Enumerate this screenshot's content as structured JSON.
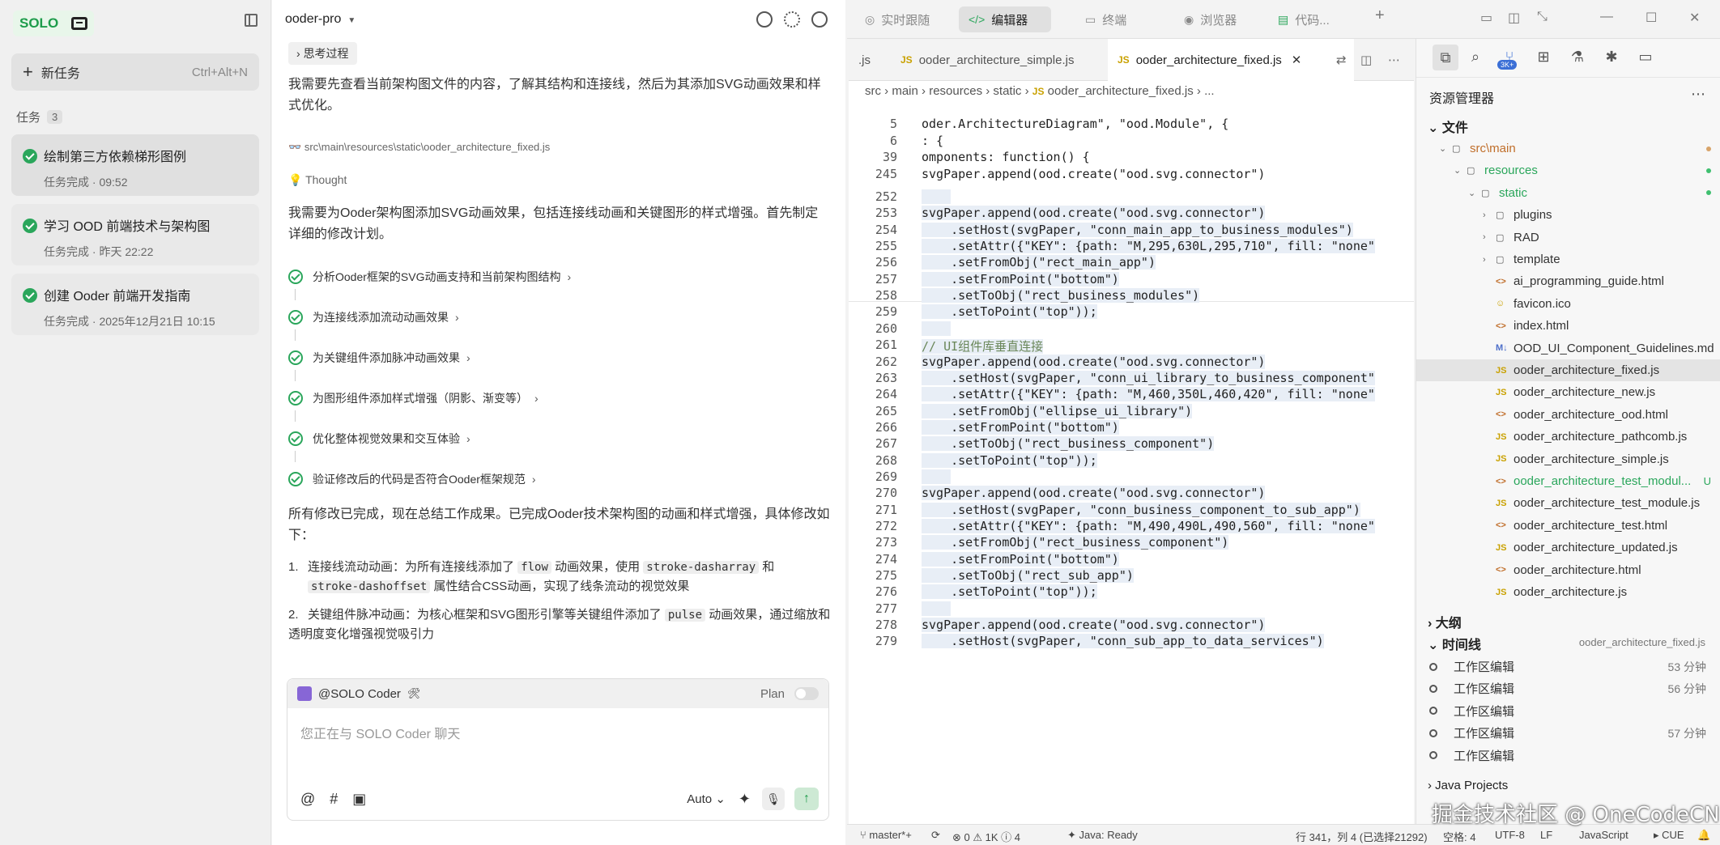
{
  "sidebar": {
    "logo": "SOLO",
    "new_task": "新任务",
    "new_task_shortcut": "Ctrl+Alt+N",
    "tasks_label": "任务",
    "tasks_count": "3",
    "tasks": [
      {
        "title": "绘制第三方依赖梯形图例",
        "status": "任务完成 · 09:52"
      },
      {
        "title": "学习 OOD 前端技术与架构图",
        "status": "任务完成 · 昨天 22:22"
      },
      {
        "title": "创建 Ooder 前端开发指南",
        "status": "任务完成 · 2025年12月21日 10:15"
      }
    ]
  },
  "chat": {
    "project": "ooder-pro",
    "thinking": "思考过程",
    "intro": "我需要先查看当前架构图文件的内容，了解其结构和连接线，然后为其添加SVG动画效果和样式优化。",
    "file_path": "src\\main\\resources\\static\\ooder_architecture_fixed.js",
    "thought": "Thought",
    "plan": "我需要为Ooder架构图添加SVG动画效果，包括连接线动画和关键图形的样式增强。首先制定详细的修改计划。",
    "steps": [
      "分析Ooder框架的SVG动画支持和当前架构图结构",
      "为连接线添加流动动画效果",
      "为关键组件添加脉冲动画效果",
      "为图形组件添加样式增强（阴影、渐变等）",
      "优化整体视觉效果和交互体验",
      "验证修改后的代码是否符合Ooder框架规范"
    ],
    "summary": "所有修改已完成，现在总结工作成果。已完成Ooder技术架构图的动画和样式增强，具体修改如下：",
    "items": [
      {
        "num": "1.",
        "pre": "连接线流动动画：为所有连接线添加了",
        "c1": "flow",
        "mid": "动画效果，使用",
        "c2": "stroke-dasharray",
        "mid2": "和",
        "c3": "stroke-dashoffset",
        "post": "属性结合CSS动画，实现了线条流动的视觉效果"
      },
      {
        "num": "2.",
        "pre": "关键组件脉冲动画：为核心框架和SVG图形引擎等关键组件添加了",
        "c1": "pulse",
        "post": "动画效果，通过缩放和透明度变化增强视觉吸引力"
      }
    ],
    "composer": {
      "agent": "@SOLO Coder",
      "plan_label": "Plan",
      "placeholder": "您正在与 SOLO Coder 聊天",
      "mode": "Auto"
    }
  },
  "topbar": {
    "buttons": [
      "实时跟随",
      "编辑器",
      "终端",
      "浏览器",
      "代码..."
    ]
  },
  "editor": {
    "tabs": [
      ".js",
      "ooder_architecture_simple.js",
      "ooder_architecture_fixed.js"
    ],
    "breadcrumb": [
      "src",
      "main",
      "resources",
      "static",
      "ooder_architecture_fixed.js",
      "..."
    ],
    "sticky": [
      {
        "n": "5",
        "t": "oder.ArchitectureDiagram\", \"ood.Module\", {"
      },
      {
        "n": "6",
        "t": ": {"
      },
      {
        "n": "39",
        "t": "omponents: function() {"
      },
      {
        "n": "245",
        "t": "svgPaper.append(ood.create(\"ood.svg.connector\")"
      }
    ],
    "lines": [
      {
        "n": "252",
        "t": ""
      },
      {
        "n": "253",
        "t": "svgPaper.append(ood.create(\"ood.svg.connector\")"
      },
      {
        "n": "254",
        "t": "    .setHost(svgPaper, \"conn_main_app_to_business_modules\")"
      },
      {
        "n": "255",
        "t": "    .setAttr({\"KEY\": {path: \"M,295,630L,295,710\", fill: \"none\""
      },
      {
        "n": "256",
        "t": "    .setFromObj(\"rect_main_app\")"
      },
      {
        "n": "257",
        "t": "    .setFromPoint(\"bottom\")"
      },
      {
        "n": "258",
        "t": "    .setToObj(\"rect_business_modules\")"
      },
      {
        "n": "259",
        "t": "    .setToPoint(\"top\"));"
      },
      {
        "n": "260",
        "t": ""
      },
      {
        "n": "261",
        "t": "// UI组件库垂直连接"
      },
      {
        "n": "262",
        "t": "svgPaper.append(ood.create(\"ood.svg.connector\")"
      },
      {
        "n": "263",
        "t": "    .setHost(svgPaper, \"conn_ui_library_to_business_component\""
      },
      {
        "n": "264",
        "t": "    .setAttr({\"KEY\": {path: \"M,460,350L,460,420\", fill: \"none\""
      },
      {
        "n": "265",
        "t": "    .setFromObj(\"ellipse_ui_library\")"
      },
      {
        "n": "266",
        "t": "    .setFromPoint(\"bottom\")"
      },
      {
        "n": "267",
        "t": "    .setToObj(\"rect_business_component\")"
      },
      {
        "n": "268",
        "t": "    .setToPoint(\"top\"));"
      },
      {
        "n": "269",
        "t": ""
      },
      {
        "n": "270",
        "t": "svgPaper.append(ood.create(\"ood.svg.connector\")"
      },
      {
        "n": "271",
        "t": "    .setHost(svgPaper, \"conn_business_component_to_sub_app\")"
      },
      {
        "n": "272",
        "t": "    .setAttr({\"KEY\": {path: \"M,490,490L,490,560\", fill: \"none\""
      },
      {
        "n": "273",
        "t": "    .setFromObj(\"rect_business_component\")"
      },
      {
        "n": "274",
        "t": "    .setFromPoint(\"bottom\")"
      },
      {
        "n": "275",
        "t": "    .setToObj(\"rect_sub_app\")"
      },
      {
        "n": "276",
        "t": "    .setToPoint(\"top\"));"
      },
      {
        "n": "277",
        "t": ""
      },
      {
        "n": "278",
        "t": "svgPaper.append(ood.create(\"ood.svg.connector\")"
      },
      {
        "n": "279",
        "t": "    .setHost(svgPaper, \"conn_sub_app_to_data_services\")"
      }
    ]
  },
  "explorer": {
    "title": "资源管理器",
    "files_label": "文件",
    "tree": [
      {
        "label": "src\\main",
        "kind": "folder",
        "indent": 1,
        "open": true,
        "status": "dot-orange"
      },
      {
        "label": "resources",
        "kind": "folder",
        "indent": 2,
        "open": true,
        "status": "dot-green"
      },
      {
        "label": "static",
        "kind": "folder",
        "indent": 3,
        "open": true,
        "status": "dot-green"
      },
      {
        "label": "plugins",
        "kind": "folder",
        "indent": 4,
        "open": false
      },
      {
        "label": "RAD",
        "kind": "folder",
        "indent": 4,
        "open": false
      },
      {
        "label": "template",
        "kind": "folder",
        "indent": 4,
        "open": false
      },
      {
        "label": "ai_programming_guide.html",
        "kind": "html",
        "indent": 4
      },
      {
        "label": "favicon.ico",
        "kind": "ico",
        "indent": 4
      },
      {
        "label": "index.html",
        "kind": "html",
        "indent": 4
      },
      {
        "label": "OOD_UI_Component_Guidelines.md",
        "kind": "md",
        "indent": 4
      },
      {
        "label": "ooder_architecture_fixed.js",
        "kind": "js",
        "indent": 4,
        "selected": true
      },
      {
        "label": "ooder_architecture_new.js",
        "kind": "js",
        "indent": 4
      },
      {
        "label": "ooder_architecture_ood.html",
        "kind": "html",
        "indent": 4
      },
      {
        "label": "ooder_architecture_pathcomb.js",
        "kind": "js",
        "indent": 4
      },
      {
        "label": "ooder_architecture_simple.js",
        "kind": "js",
        "indent": 4
      },
      {
        "label": "ooder_architecture_test_modul...",
        "kind": "html",
        "indent": 4,
        "status": "U"
      },
      {
        "label": "ooder_architecture_test_module.js",
        "kind": "js",
        "indent": 4
      },
      {
        "label": "ooder_architecture_test.html",
        "kind": "html",
        "indent": 4
      },
      {
        "label": "ooder_architecture_updated.js",
        "kind": "js",
        "indent": 4
      },
      {
        "label": "ooder_architecture.html",
        "kind": "html",
        "indent": 4
      },
      {
        "label": "ooder_architecture.js",
        "kind": "js",
        "indent": 4
      }
    ],
    "outline_label": "大纲",
    "timeline_label": "时间线",
    "timeline_file": "ooder_architecture_fixed.js",
    "timeline": [
      {
        "label": "工作区编辑",
        "time": "53 分钟"
      },
      {
        "label": "工作区编辑",
        "time": "56 分钟"
      },
      {
        "label": "工作区编辑",
        "time": ""
      },
      {
        "label": "工作区编辑",
        "time": "57 分钟"
      },
      {
        "label": "工作区编辑",
        "time": ""
      }
    ],
    "java_projects": "Java Projects"
  },
  "statusbar": {
    "branch": "master*+",
    "errors": "0",
    "warnings": "1K",
    "info": "4",
    "java": "Java: Ready",
    "position": "行 341，列 4 (已选择21292)",
    "spaces": "空格: 4",
    "encoding": "UTF-8",
    "eol": "LF",
    "language": "JavaScript",
    "cue": "CUE"
  },
  "watermark": "掘金技术社区 @ OneCodeCN",
  "colors": {
    "accent_green": "#2aa65b",
    "brand_green": "#1d9c4b",
    "selection": "#e8eef6",
    "js_yellow": "#c9a100"
  }
}
